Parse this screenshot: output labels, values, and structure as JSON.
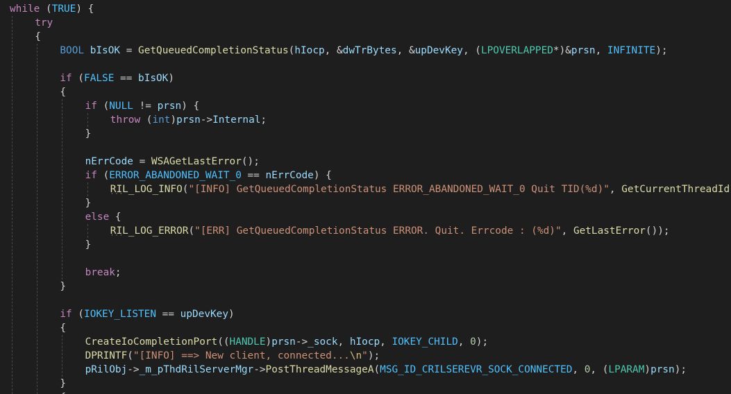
{
  "colors": {
    "background": "#1e1e1e",
    "keyword_control": "#c586c0",
    "keyword_type": "#569cd6",
    "function": "#dcdcaa",
    "variable": "#9cdcfe",
    "constant": "#4fc1ff",
    "string": "#ce9178",
    "escape": "#d7ba7d",
    "number": "#b5cea8",
    "type_name": "#4ec9b0",
    "plain": "#d4d4d4",
    "indent_guide": "#4a4a4a"
  },
  "lines": [
    {
      "indent": 0,
      "tokens": [
        [
          "kw",
          "while"
        ],
        [
          "pun",
          " ("
        ],
        [
          "con",
          "TRUE"
        ],
        [
          "pun",
          ") {"
        ]
      ]
    },
    {
      "indent": 1,
      "tokens": [
        [
          "kw",
          "try"
        ]
      ]
    },
    {
      "indent": 1,
      "tokens": [
        [
          "pun",
          "{"
        ]
      ]
    },
    {
      "indent": 2,
      "tokens": [
        [
          "ty",
          "BOOL"
        ],
        [
          "pun",
          " "
        ],
        [
          "var",
          "bIsOK"
        ],
        [
          "pun",
          " = "
        ],
        [
          "fn",
          "GetQueuedCompletionStatus"
        ],
        [
          "pun",
          "("
        ],
        [
          "var",
          "hIocp"
        ],
        [
          "pun",
          ", &"
        ],
        [
          "var",
          "dwTrBytes"
        ],
        [
          "pun",
          ", &"
        ],
        [
          "var",
          "upDevKey"
        ],
        [
          "pun",
          ", ("
        ],
        [
          "tcast",
          "LPOVERLAPPED"
        ],
        [
          "pun",
          "*)&"
        ],
        [
          "var",
          "prsn"
        ],
        [
          "pun",
          ", "
        ],
        [
          "con",
          "INFINITE"
        ],
        [
          "pun",
          ");"
        ]
      ]
    },
    {
      "indent": 2,
      "tokens": []
    },
    {
      "indent": 2,
      "tokens": [
        [
          "kw",
          "if"
        ],
        [
          "pun",
          " ("
        ],
        [
          "con",
          "FALSE"
        ],
        [
          "pun",
          " == "
        ],
        [
          "var",
          "bIsOK"
        ],
        [
          "pun",
          ")"
        ]
      ]
    },
    {
      "indent": 2,
      "tokens": [
        [
          "pun",
          "{"
        ]
      ]
    },
    {
      "indent": 3,
      "tokens": [
        [
          "kw",
          "if"
        ],
        [
          "pun",
          " ("
        ],
        [
          "con",
          "NULL"
        ],
        [
          "pun",
          " != "
        ],
        [
          "var",
          "prsn"
        ],
        [
          "pun",
          ") {"
        ]
      ]
    },
    {
      "indent": 4,
      "tokens": [
        [
          "kw",
          "throw"
        ],
        [
          "pun",
          " ("
        ],
        [
          "ty",
          "int"
        ],
        [
          "pun",
          ")"
        ],
        [
          "var",
          "prsn"
        ],
        [
          "pun",
          "->"
        ],
        [
          "var",
          "Internal"
        ],
        [
          "pun",
          ";"
        ]
      ]
    },
    {
      "indent": 3,
      "tokens": [
        [
          "pun",
          "}"
        ]
      ]
    },
    {
      "indent": 3,
      "tokens": []
    },
    {
      "indent": 3,
      "tokens": [
        [
          "var",
          "nErrCode"
        ],
        [
          "pun",
          " = "
        ],
        [
          "fn",
          "WSAGetLastError"
        ],
        [
          "pun",
          "();"
        ]
      ]
    },
    {
      "indent": 3,
      "tokens": [
        [
          "kw",
          "if"
        ],
        [
          "pun",
          " ("
        ],
        [
          "con",
          "ERROR_ABANDONED_WAIT_0"
        ],
        [
          "pun",
          " == "
        ],
        [
          "var",
          "nErrCode"
        ],
        [
          "pun",
          ") {"
        ]
      ]
    },
    {
      "indent": 4,
      "dots": true,
      "tokens": [
        [
          "mac",
          "RIL_LOG_INFO"
        ],
        [
          "pun",
          "("
        ],
        [
          "str",
          "\"[INFO] GetQueuedCompletionStatus ERROR_ABANDONED_WAIT_0 Quit TID(%d)\""
        ],
        [
          "pun",
          ", "
        ],
        [
          "fn",
          "GetCurrentThreadId"
        ],
        [
          "pun",
          "());"
        ]
      ]
    },
    {
      "indent": 3,
      "tokens": [
        [
          "pun",
          "}"
        ]
      ]
    },
    {
      "indent": 3,
      "tokens": [
        [
          "kw",
          "else"
        ],
        [
          "pun",
          " {"
        ]
      ]
    },
    {
      "indent": 4,
      "dots": true,
      "tokens": [
        [
          "mac",
          "RIL_LOG_ERROR"
        ],
        [
          "pun",
          "("
        ],
        [
          "str",
          "\"[ERR] GetQueuedCompletionStatus ERROR. Quit. Errcode : (%d)\""
        ],
        [
          "pun",
          ", "
        ],
        [
          "fn",
          "GetLastError"
        ],
        [
          "pun",
          "());"
        ]
      ]
    },
    {
      "indent": 3,
      "tokens": [
        [
          "pun",
          "}"
        ]
      ]
    },
    {
      "indent": 3,
      "tokens": []
    },
    {
      "indent": 3,
      "tokens": [
        [
          "kw",
          "break"
        ],
        [
          "pun",
          ";"
        ]
      ]
    },
    {
      "indent": 2,
      "tokens": [
        [
          "pun",
          "}"
        ]
      ]
    },
    {
      "indent": 2,
      "tokens": []
    },
    {
      "indent": 2,
      "tokens": [
        [
          "kw",
          "if"
        ],
        [
          "pun",
          " ("
        ],
        [
          "con",
          "IOKEY_LISTEN"
        ],
        [
          "pun",
          " == "
        ],
        [
          "var",
          "upDevKey"
        ],
        [
          "pun",
          ")"
        ]
      ]
    },
    {
      "indent": 2,
      "tokens": [
        [
          "pun",
          "{"
        ]
      ]
    },
    {
      "indent": 3,
      "tokens": [
        [
          "fn",
          "CreateIoCompletionPort"
        ],
        [
          "pun",
          "(("
        ],
        [
          "tcast",
          "HANDLE"
        ],
        [
          "pun",
          ")"
        ],
        [
          "var",
          "prsn"
        ],
        [
          "pun",
          "->"
        ],
        [
          "var",
          "_sock"
        ],
        [
          "pun",
          ", "
        ],
        [
          "var",
          "hIocp"
        ],
        [
          "pun",
          ", "
        ],
        [
          "con",
          "IOKEY_CHILD"
        ],
        [
          "pun",
          ", "
        ],
        [
          "num",
          "0"
        ],
        [
          "pun",
          ");"
        ]
      ]
    },
    {
      "indent": 3,
      "tokens": [
        [
          "mac",
          "DPRINTF"
        ],
        [
          "pun",
          "("
        ],
        [
          "str",
          "\"[INFO] ==> New client, connected..."
        ],
        [
          "esc",
          "\\n"
        ],
        [
          "str",
          "\""
        ],
        [
          "pun",
          ");"
        ]
      ]
    },
    {
      "indent": 3,
      "tokens": [
        [
          "var",
          "pRilObj"
        ],
        [
          "pun",
          "->"
        ],
        [
          "var",
          "_m_pThdRilServerMgr"
        ],
        [
          "pun",
          "->"
        ],
        [
          "fn",
          "PostThreadMessageA"
        ],
        [
          "pun",
          "("
        ],
        [
          "con",
          "MSG_ID_CRILSEREVR_SOCK_CONNECTED"
        ],
        [
          "pun",
          ", "
        ],
        [
          "num",
          "0"
        ],
        [
          "pun",
          ", ("
        ],
        [
          "tcast",
          "LPARAM"
        ],
        [
          "pun",
          ")"
        ],
        [
          "var",
          "prsn"
        ],
        [
          "pun",
          ");"
        ]
      ]
    },
    {
      "indent": 2,
      "tokens": [
        [
          "pun",
          "}"
        ]
      ]
    },
    {
      "indent": 2,
      "tokens": [
        [
          "pun",
          "{"
        ]
      ]
    }
  ]
}
